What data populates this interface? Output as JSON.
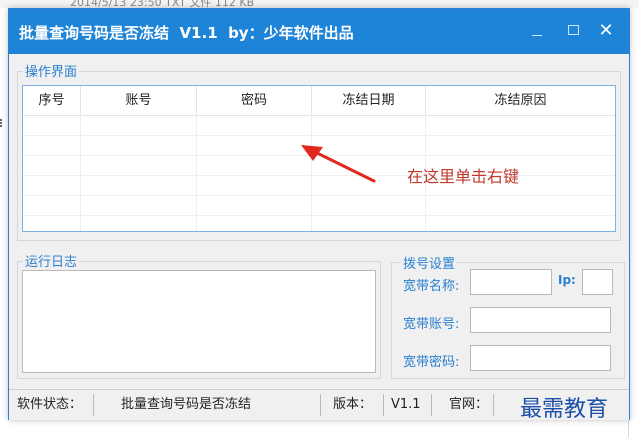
{
  "background": {
    "top_text": "2014/5/13 23:50        TXT 文件        112 KB"
  },
  "window": {
    "title": "批量查询号码是否冻结  V1.1  by：少年软件出品",
    "close_glyph": "✕"
  },
  "operations": {
    "group_label": "操作界面",
    "columns": [
      "序号",
      "账号",
      "密码",
      "冻结日期",
      "冻结原因"
    ],
    "hint": "在这里单击右键"
  },
  "log": {
    "group_label": "运行日志"
  },
  "dial": {
    "group_label": "拨号设置",
    "name_label": "宽带名称:",
    "ip_label": "Ip:",
    "account_label": "宽带账号:",
    "password_label": "宽带密码:",
    "name_value": "",
    "ip_value": "",
    "account_value": "",
    "password_value": ""
  },
  "status": {
    "state_label": "软件状态：",
    "state_value": "批量查询号码是否冻结",
    "version_label": "版本：",
    "version_value": "V1.1",
    "site_label": "官网："
  },
  "watermark": "最需教育",
  "colors": {
    "titlebar": "#1e84d8",
    "accent_text": "#2a7fd0",
    "hint_text": "#c0392b"
  }
}
